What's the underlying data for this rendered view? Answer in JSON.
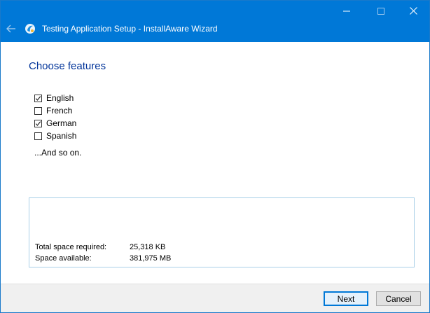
{
  "window": {
    "title": "Testing Application Setup - InstallAware Wizard",
    "icons": [
      "back-arrow-icon",
      "installaware-app-icon",
      "minimize-icon",
      "maximize-icon",
      "close-icon"
    ]
  },
  "page": {
    "heading": "Choose features",
    "features": [
      {
        "label": "English",
        "checked": true
      },
      {
        "label": "French",
        "checked": false
      },
      {
        "label": "German",
        "checked": true
      },
      {
        "label": "Spanish",
        "checked": false
      }
    ],
    "note": "...And so on."
  },
  "space": {
    "required_label": "Total space required:",
    "required_value": "25,318 KB",
    "available_label": "Space available:",
    "available_value": "381,975 MB"
  },
  "buttons": {
    "next": "Next",
    "cancel": "Cancel"
  },
  "colors": {
    "titlebar": "#0078d7",
    "heading": "#003399",
    "footer": "#f0f0f0",
    "default_button_border": "#0078d7"
  }
}
